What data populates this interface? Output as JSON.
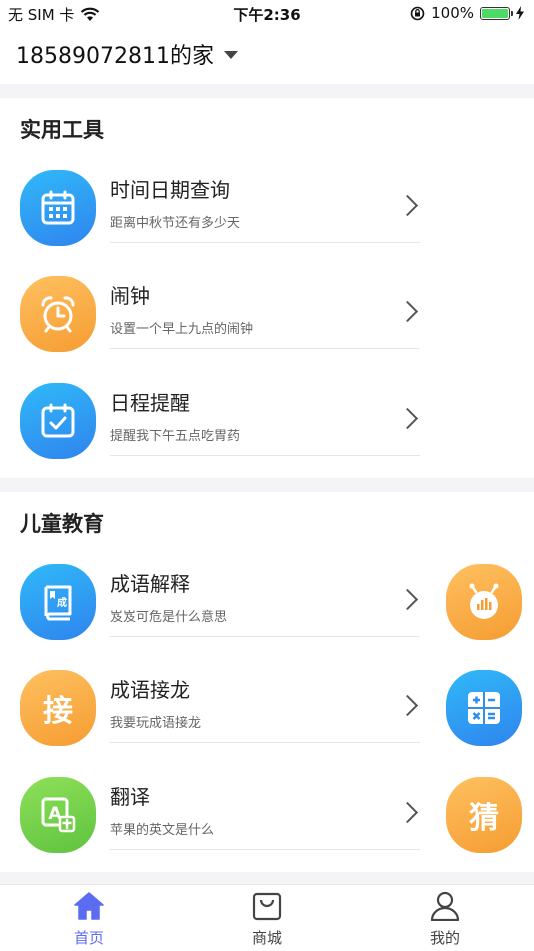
{
  "status_bar": {
    "carrier": "无 SIM 卡",
    "time": "下午2:36",
    "battery_text": "100%",
    "battery_level": 1.0
  },
  "header": {
    "home_name": "18589072811的家"
  },
  "sections": {
    "tools": {
      "title": "实用工具",
      "items": [
        {
          "title": "时间日期查询",
          "subtitle": "距离中秋节还有多少天"
        },
        {
          "title": "闹钟",
          "subtitle": "设置一个早上九点的闹钟"
        },
        {
          "title": "日程提醒",
          "subtitle": "提醒我下午五点吃胃药"
        }
      ]
    },
    "education": {
      "title": "儿童教育",
      "items": [
        {
          "title": "成语解释",
          "subtitle": "岌岌可危是什么意思"
        },
        {
          "title": "成语接龙",
          "subtitle": "我要玩成语接龙"
        },
        {
          "title": "翻译",
          "subtitle": "苹果的英文是什么"
        }
      ],
      "glyphs": {
        "book": "成",
        "jielong": "接",
        "translate": "A",
        "guess": "猜"
      }
    }
  },
  "tabbar": {
    "tabs": [
      {
        "label": "首页",
        "icon": "home-icon",
        "active": true
      },
      {
        "label": "商城",
        "icon": "shopping-bag-icon",
        "active": false
      },
      {
        "label": "我的",
        "icon": "user-icon",
        "active": false
      }
    ]
  },
  "colors": {
    "active_tab": "#5b6cf0",
    "inactive_tab": "#444444",
    "icon_blue": "#2f9bf2",
    "icon_orange": "#f7a63c",
    "icon_green": "#6fcc45"
  }
}
